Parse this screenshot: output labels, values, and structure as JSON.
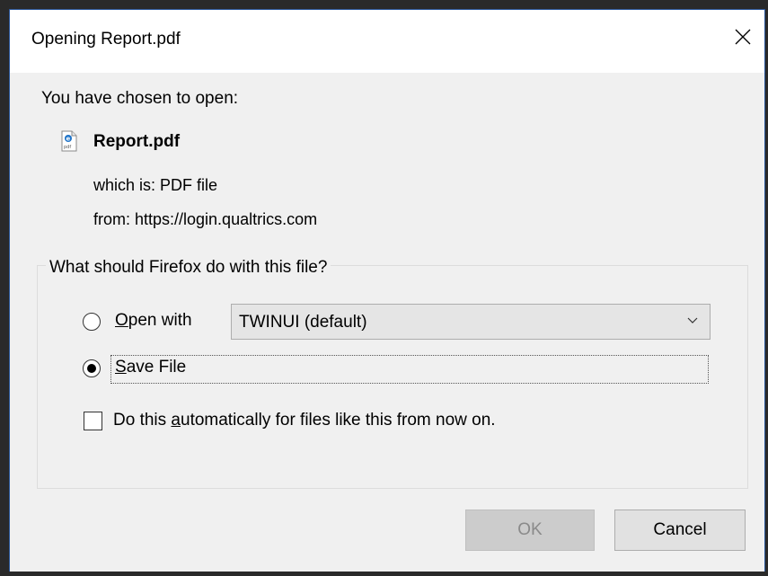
{
  "dialog": {
    "title": "Opening Report.pdf",
    "close_icon": "close-icon"
  },
  "info": {
    "chosen_label": "You have chosen to open:",
    "file_icon": "pdf-file-icon",
    "file_name": "Report.pdf",
    "which_is": "which is: PDF file",
    "from": "from: https://login.qualtrics.com"
  },
  "action_group": {
    "legend": "What should Firefox do with this file?",
    "open_with": {
      "label_accel": "O",
      "label_rest": "pen with",
      "selected": false,
      "app_value": "TWINUI (default)"
    },
    "save_file": {
      "label_accel": "S",
      "label_rest": "ave File",
      "selected": true
    },
    "auto_checkbox": {
      "label_pre": "Do this ",
      "label_accel": "a",
      "label_post": "utomatically for files like this from now on.",
      "checked": false
    }
  },
  "buttons": {
    "ok": "OK",
    "cancel": "Cancel"
  },
  "colors": {
    "dialog_bg": "#f0f0f0",
    "border_accent": "#2b579a",
    "ok_disabled_text": "#8a8a8a"
  }
}
